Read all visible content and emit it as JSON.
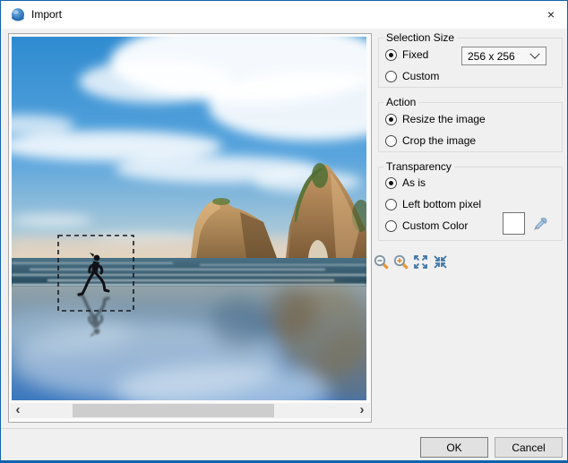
{
  "window": {
    "title": "Import",
    "close_glyph": "×"
  },
  "selection_size": {
    "label": "Selection Size",
    "options": {
      "fixed": {
        "label": "Fixed",
        "selected": true
      },
      "custom": {
        "label": "Custom",
        "selected": false
      }
    },
    "dropdown": {
      "value": "256 x 256"
    }
  },
  "action": {
    "label": "Action",
    "options": {
      "resize": {
        "label": "Resize the image",
        "selected": true
      },
      "crop": {
        "label": "Crop the image",
        "selected": false
      }
    }
  },
  "transparency": {
    "label": "Transparency",
    "options": {
      "as_is": {
        "label": "As is",
        "selected": true
      },
      "left_bottom": {
        "label": "Left bottom pixel",
        "selected": false
      },
      "custom_color": {
        "label": "Custom Color",
        "selected": false
      }
    },
    "swatch_color": "#ffffff"
  },
  "zoom_toolbar": {
    "icons": [
      "zoom-out-icon",
      "zoom-in-icon",
      "fit-to-window-icon",
      "actual-size-icon"
    ]
  },
  "scrollbar": {
    "left_arrow": "‹",
    "right_arrow": "›"
  },
  "footer": {
    "ok_label": "OK",
    "cancel_label": "Cancel"
  },
  "colors": {
    "window_border": "#1262ab",
    "magnifier_handle": "#e59a3c",
    "icon_blue": "#3f76a6",
    "scroll_thumb": "#cdcdcd"
  }
}
